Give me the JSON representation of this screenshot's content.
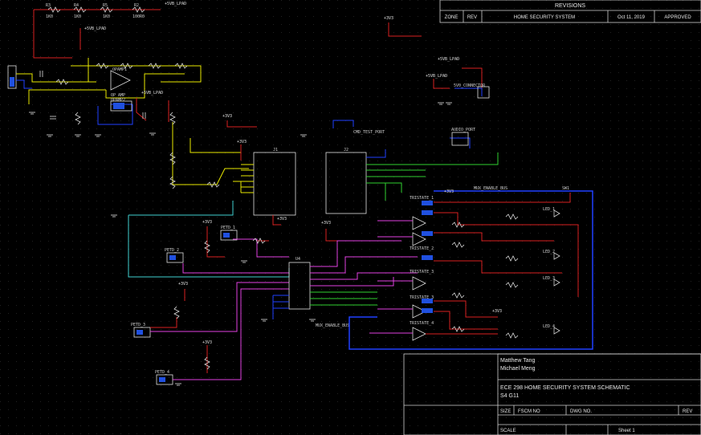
{
  "title_block": {
    "revisions_header": "REVISIONS",
    "zone_label": "ZONE",
    "rev_label": "REV",
    "rev_description": "HOME SECURITY SYSTEM",
    "rev_date": "Oct 11, 2019",
    "rev_status": "APPROVED",
    "author_1": "Matthew Tang",
    "author_2": "Michael Meng",
    "drawing_title": "ECE 298 HOME SECURITY SYSTEM SCHEMATIC",
    "group": "S4 G11",
    "size_label": "SIZE",
    "fscm_label": "FSCM NO",
    "dwg_label": "DWG NO.",
    "rev_col_label": "REV",
    "scale_label": "SCALE",
    "sheet_label": "Sheet 1"
  },
  "power_labels": {
    "v5_lpad": "+5VB_LPAD",
    "v3v3": "+3V3",
    "gnd": "GND"
  },
  "components": {
    "r3": "R3",
    "r4": "R4",
    "r5": "R5",
    "r2": "R2",
    "r3_val": "1K0",
    "r4_val": "1K0",
    "r5_val": "1K0",
    "r2_val": "100R0",
    "opamp1": "OPAMP1",
    "opamp2": "OPAMP2",
    "op_amp": "OP AMP",
    "j1": "J1",
    "j2": "J2",
    "u4": "U4",
    "sw1": "SW1",
    "led1": "LED_1",
    "led2": "LED_2",
    "led3": "LED_3",
    "led4": "LED_4",
    "pir1": "PETD_1",
    "pir2": "PETD_2",
    "pir3": "PETD_3",
    "pir4": "PETD_4",
    "tri1": "TRISTATE_1",
    "tri2": "TRISTATE_2",
    "tri3": "TRISTATE_3",
    "tri4": "TRISTATE_4",
    "cmd_port": "CMD_TEST_PORT",
    "audio_port": "AUDIO_PORT",
    "conn_5v": "5V0_CONNECTOR",
    "bus_label": "MUX_ENABLE_BUS",
    "bus_label2": "MUX_ENABLE_BUS"
  },
  "colors": {
    "wire_yellow": "#e8e800",
    "wire_red": "#d82020",
    "wire_blue": "#2040ff",
    "wire_green": "#30d030",
    "wire_cyan": "#40d0d0",
    "wire_magenta": "#e040e0",
    "wire_orange": "#f08020",
    "wire_white": "#e0e0e0",
    "grid_dot": "#1a1a1a"
  }
}
